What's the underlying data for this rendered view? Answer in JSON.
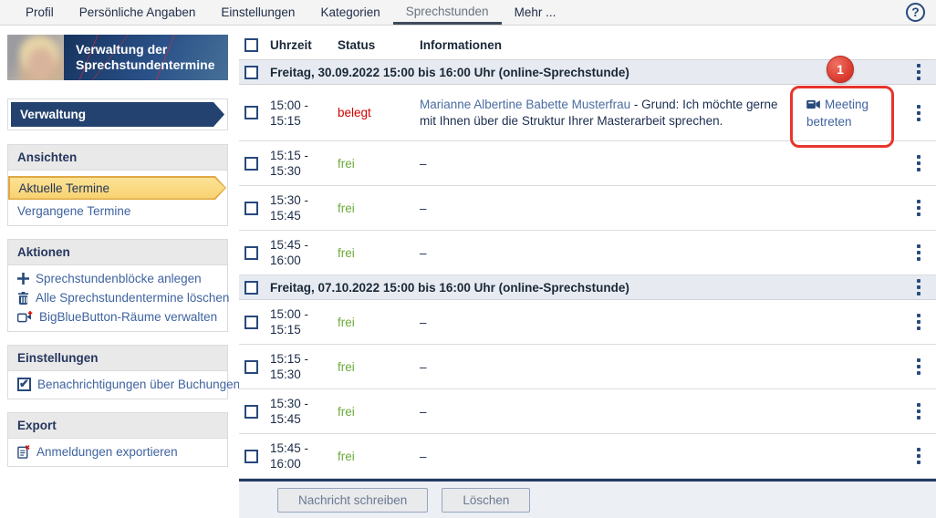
{
  "colors": {
    "accent_navy": "#28497c",
    "status_free": "#6cab3a",
    "status_busy": "#d60000",
    "annotation_red": "#e8352c",
    "active_item_yellow": "#f9d67a"
  },
  "nav": {
    "items": [
      {
        "label": "Profil"
      },
      {
        "label": "Persönliche Angaben"
      },
      {
        "label": "Einstellungen"
      },
      {
        "label": "Kategorien"
      },
      {
        "label": "Sprechstunden"
      },
      {
        "label": "Mehr ..."
      }
    ],
    "active": "Sprechstunden"
  },
  "sidebar": {
    "banner_title": "Verwaltung der Sprechstundentermine",
    "nav_button": "Verwaltung",
    "ansichten": {
      "title": "Ansichten",
      "active_item": "Aktuelle Termine",
      "item2": "Vergangene Termine"
    },
    "aktionen": {
      "title": "Aktionen",
      "item1": "Sprechstundenblöcke anlegen",
      "item2": "Alle Sprechstundentermine löschen",
      "item3": "BigBlueButton-Räume verwalten"
    },
    "einstellungen": {
      "title": "Einstellungen",
      "checkbox_label": "Benachrichtigungen über Buchungen",
      "checked": true
    },
    "export": {
      "title": "Export",
      "item1": "Anmeldungen exportieren"
    }
  },
  "table": {
    "columns": {
      "time": "Uhrzeit",
      "status": "Status",
      "info": "Informationen"
    },
    "groups": [
      {
        "header": "Freitag, 30.09.2022 15:00 bis 16:00 Uhr (online-Sprechstunde)",
        "rows": [
          {
            "time_a": "15:00 -",
            "time_b": "15:15",
            "status": "belegt",
            "link": "Marianne Albertine Babette Musterfrau",
            "reason": " - Grund: Ich möchte gerne mit Ihnen über die Struktur Ihrer Masterarbeit sprechen.",
            "action": "Meeting betreten"
          },
          {
            "time_a": "15:15 -",
            "time_b": "15:30",
            "status": "frei",
            "info": "–"
          },
          {
            "time_a": "15:30 -",
            "time_b": "15:45",
            "status": "frei",
            "info": "–"
          },
          {
            "time_a": "15:45 -",
            "time_b": "16:00",
            "status": "frei",
            "info": "–"
          }
        ]
      },
      {
        "header": "Freitag, 07.10.2022 15:00 bis 16:00 Uhr (online-Sprechstunde)",
        "rows": [
          {
            "time_a": "15:00 -",
            "time_b": "15:15",
            "status": "frei",
            "info": "–"
          },
          {
            "time_a": "15:15 -",
            "time_b": "15:30",
            "status": "frei",
            "info": "–"
          },
          {
            "time_a": "15:30 -",
            "time_b": "15:45",
            "status": "frei",
            "info": "–"
          },
          {
            "time_a": "15:45 -",
            "time_b": "16:00",
            "status": "frei",
            "info": "–"
          }
        ]
      }
    ],
    "footer": {
      "message_button": "Nachricht schreiben",
      "delete_button": "Löschen"
    }
  },
  "annotation": {
    "badge": "1"
  }
}
